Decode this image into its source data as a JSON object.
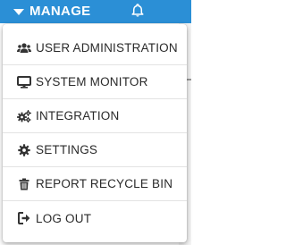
{
  "header": {
    "menu_label": "MANAGE",
    "caret_icon": "caret-down-icon",
    "bell_icon": "bell-icon",
    "bar_color": "#2b8fd6"
  },
  "menu": {
    "items": [
      {
        "label": "USER ADMINISTRATION",
        "icon": "users-icon"
      },
      {
        "label": "SYSTEM MONITOR",
        "icon": "desktop-icon"
      },
      {
        "label": "INTEGRATION",
        "icon": "cogs-icon"
      },
      {
        "label": "SETTINGS",
        "icon": "gear-icon"
      },
      {
        "label": "REPORT RECYCLE BIN",
        "icon": "trash-icon"
      },
      {
        "label": "LOG OUT",
        "icon": "sign-out-icon"
      }
    ]
  }
}
